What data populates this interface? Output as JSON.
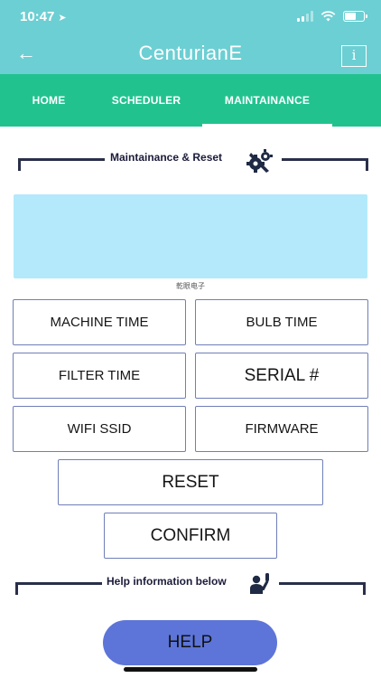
{
  "status_bar": {
    "time": "10:47",
    "location_glyph": "➤"
  },
  "header": {
    "back_glyph": "←",
    "title": "CenturianE",
    "info_glyph": "i"
  },
  "tabs": [
    {
      "label": "HOME",
      "selected": false
    },
    {
      "label": "SCHEDULER",
      "selected": false
    },
    {
      "label": "MAINTAINANCE",
      "selected": true
    }
  ],
  "maintenance": {
    "heading": "Maintainance & Reset",
    "heading_icon": "gear-wrench-icon",
    "display_caption": "乾眼电子",
    "buttons": {
      "machine_time": "MACHINE TIME",
      "bulb_time": "BULB TIME",
      "filter_time": "FILTER TIME",
      "serial": "SERIAL #",
      "wifi_ssid": "WIFI SSID",
      "firmware": "FIRMWARE",
      "reset": "RESET",
      "confirm": "CONFIRM"
    }
  },
  "help": {
    "heading": "Help information below",
    "heading_icon": "raised-hand-person-icon",
    "button": "HELP"
  },
  "colors": {
    "title_bar": "#6ccfd3",
    "tab_bar": "#22c28f",
    "display_panel": "#b3e9fb",
    "help_button": "#5d75d8",
    "button_border": "#6f7fb8"
  }
}
